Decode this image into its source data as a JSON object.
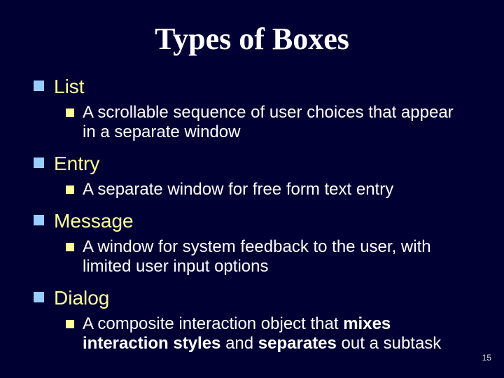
{
  "slide": {
    "title": "Types of Boxes",
    "number": "15",
    "items": [
      {
        "label": "List",
        "sub": "A scrollable sequence of user choices that appear in a separate window"
      },
      {
        "label": "Entry",
        "sub": "A separate window for free form text entry"
      },
      {
        "label": "Message",
        "sub": "A window for system feedback to the user, with limited user input options"
      },
      {
        "label": "Dialog",
        "sub_html": "A composite interaction object that <b>mixes interaction styles</b> and <b>separates</b> out a subtask"
      }
    ]
  }
}
